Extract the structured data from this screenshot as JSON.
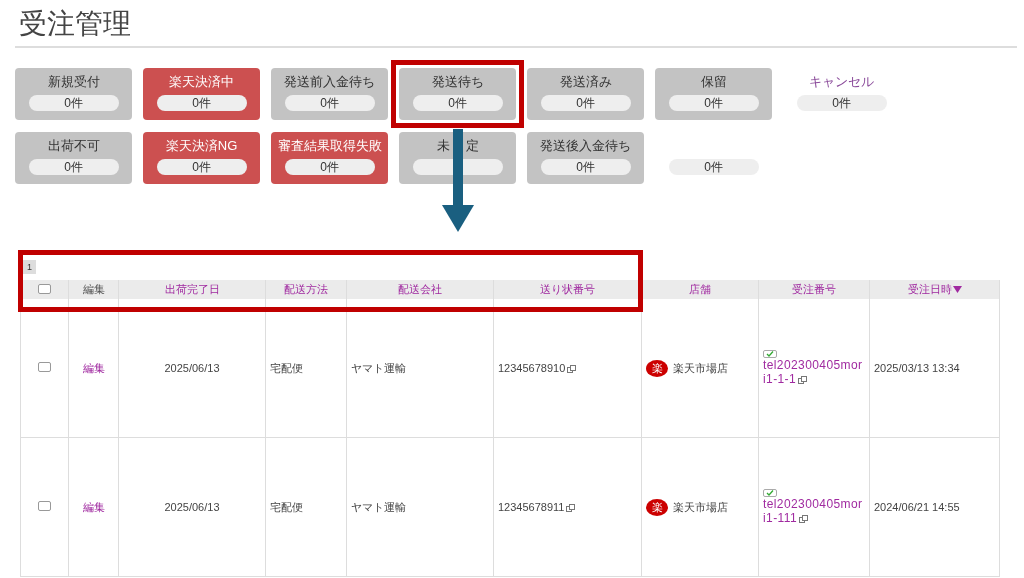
{
  "title": "受注管理",
  "status_cards": [
    {
      "label": "新規受付",
      "count": "0件",
      "kind": "gray",
      "highlighted": false
    },
    {
      "label": "楽天決済中",
      "count": "0件",
      "kind": "red",
      "highlighted": false
    },
    {
      "label": "発送前入金待ち",
      "count": "0件",
      "kind": "gray",
      "highlighted": false
    },
    {
      "label": "発送待ち",
      "count": "0件",
      "kind": "gray",
      "highlighted": true
    },
    {
      "label": "発送済み",
      "count": "0件",
      "kind": "gray",
      "highlighted": false
    },
    {
      "label": "保留",
      "count": "0件",
      "kind": "gray",
      "highlighted": false
    },
    {
      "label": "キャンセル",
      "count": "0件",
      "kind": "plain",
      "highlighted": false
    },
    {
      "label": "出荷不可",
      "count": "0件",
      "kind": "gray",
      "highlighted": false
    },
    {
      "label": "楽天決済NG",
      "count": "0件",
      "kind": "red",
      "highlighted": false
    },
    {
      "label": "審査結果取得失敗",
      "count": "0件",
      "kind": "red",
      "highlighted": false
    },
    {
      "label_parts": [
        "未",
        "定"
      ],
      "kind": "gray",
      "highlighted": false
    },
    {
      "label": "発送後入金待ち",
      "count": "0件",
      "kind": "gray",
      "highlighted": false
    },
    {
      "count": "0件",
      "kind": "plain",
      "highlighted": false
    }
  ],
  "table": {
    "page": "1",
    "header_highlighted": true,
    "columns": [
      {
        "kind": "checkbox",
        "checked": false
      },
      {
        "label": "編集",
        "kind": "plain",
        "sorted": false
      },
      {
        "label": "出荷完了日",
        "kind": "sortable",
        "sorted": false
      },
      {
        "label": "配送方法",
        "kind": "sortable",
        "sorted": false
      },
      {
        "label": "配送会社",
        "kind": "sortable",
        "sorted": false
      },
      {
        "label": "送り状番号",
        "kind": "sortable",
        "sorted": false
      },
      {
        "label": "店舗",
        "kind": "sortable",
        "sorted": false
      },
      {
        "label": "受注番号",
        "kind": "sortable",
        "sorted": false
      },
      {
        "label": "受注日時",
        "kind": "sortable",
        "sorted": true
      }
    ],
    "rows": [
      {
        "checked": false,
        "edit": "編集",
        "ship_date": "2025/06/13",
        "method": "宅配便",
        "carrier": "ヤマト運輸",
        "tracking": "12345678910",
        "shop_badge": "楽",
        "shop": "楽天市場店",
        "order_no": "tel202300405mori1-1-1",
        "order_date": "2025/03/13 13:34"
      },
      {
        "checked": false,
        "edit": "編集",
        "ship_date": "2025/06/13",
        "method": "宅配便",
        "carrier": "ヤマト運輸",
        "tracking": "12345678911",
        "shop_badge": "楽",
        "shop": "楽天市場店",
        "order_no": "tel202300405mori1-111",
        "order_date": "2024/06/21 14:55"
      }
    ]
  }
}
